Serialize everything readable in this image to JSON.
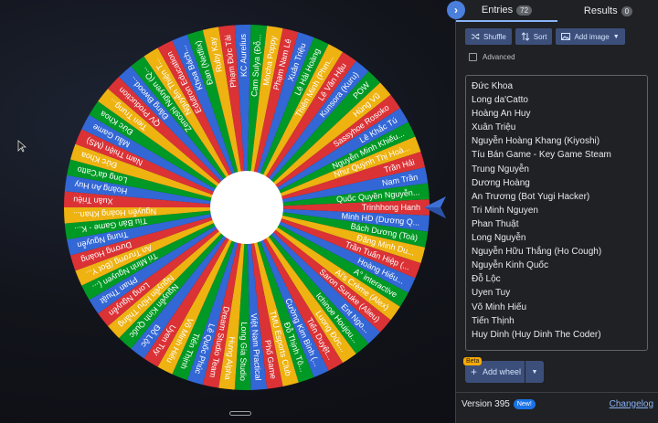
{
  "wheel": {
    "segment_colors": [
      "#db3236",
      "#3367d6",
      "#009925",
      "#eeb211"
    ],
    "labels": [
      "Trinhhong Hanh",
      "Minh HD (Dương Q...",
      "Bách Dương (Toà)",
      "Đặng Minh Du...",
      "Trần Tuấn Hiệp (...",
      "Hoàng Hiếu...",
      "A° interactive",
      "Ai's Crème (Alex)",
      "Saron Suruke (Alieu)",
      "Ent Ngo...",
      "Ichinoe Houjou...",
      "Luong Đức...",
      "Tiến Duyệt...",
      "Cường Kim Bình (...",
      "Đỗ Thịnh Tô...",
      "TMU Esports Club",
      "Phố Game",
      "Việt Nam Practical",
      "Long Gia Studio",
      "Hưng Alpha",
      "Dream Studio Team",
      "Lê Quốc Phúc",
      "Tiến Thịnh",
      "Võ Minh Hiếu",
      "Uyen Tuy",
      "Đỗ Lộc",
      "Nguyễn Kinh Quốc",
      "Nguyễn Hữu Thắng",
      "Long Nguyễn",
      "Phan Thuật",
      "Tri Minh Nguyen (...",
      "An Trương (Bot Y...",
      "Dương Hoàng",
      "Trung Nguyễn",
      "Tíu Bán Game - K...",
      "Nguyễn Hoàng Khan...",
      "Xuân Triệu",
      "Hoàng An Huy",
      "Long da'Catto",
      "Đức Khoa",
      "Nam Thiện (MS)",
      "Mẫu Game",
      "Đức Khoa",
      "Tien Trung...",
      "QV Production",
      "Đăng Bwood...",
      "Zenoshi Nguyen (Q...",
      "Nguyễn Thiện T...",
      "Edutron Education",
      "Khoa Bách...",
      "Đan (Netflix)",
      "Ruby Kay",
      "Phạm Đức Tài",
      "KC Aurelius",
      "Cam Sulya (Đỗ...",
      "Mocha Poppy",
      "Phạm Nam Lê",
      "Xuân Triệu",
      "Lê Hải Hoàng",
      "Thiên Minh (Phm...",
      "Lê Văn Hậu",
      "Kunsora (Kuru)",
      "POW",
      "Hùng Vũ",
      "Sassyhoe Rosoko",
      "Lê Khắc Tú",
      "Nguyễn Minh Khiếu...",
      "Như Quỳnh Thị Hoà...",
      "Trần Hải",
      "Nam Trần",
      "Quốc Quyền Nguyễn..."
    ]
  },
  "tabs": {
    "entries_label": "Entries",
    "entries_count": "72",
    "results_label": "Results",
    "results_count": "0"
  },
  "toolbar": {
    "shuffle_label": "Shuffle",
    "sort_label": "Sort",
    "add_image_label": "Add image"
  },
  "advanced_label": "Advanced",
  "entries": [
    "Đức Khoa",
    "Long da'Catto",
    "Hoàng An Huy",
    "Xuân Triệu",
    "Nguyễn Hoàng Khang (Kiyoshi)",
    "Tíu Bán Game - Key Game Steam",
    "Trung Nguyễn",
    "Dương Hoàng",
    "An Trương (Bot Yugi Hacker)",
    "Tri Minh Nguyen",
    "Phan Thuật",
    "Long Nguyễn",
    "Nguyễn Hữu Thắng (Ho Cough)",
    "Nguyễn Kinh Quốc",
    "Đỗ Lộc",
    "Uyen Tuy",
    "Võ Minh Hiếu",
    "Tiến Thịnh",
    "Huy Dinh (Huy Dinh The Coder)"
  ],
  "add_wheel": {
    "beta_label": "Beta",
    "label": "Add wheel"
  },
  "footer": {
    "version_label": "Version 395",
    "new_label": "New!",
    "changelog_label": "Changelog"
  },
  "colors": {
    "accent": "#4a7fdb",
    "panel_bg": "#202124",
    "pointer": "#3d6fd8"
  }
}
